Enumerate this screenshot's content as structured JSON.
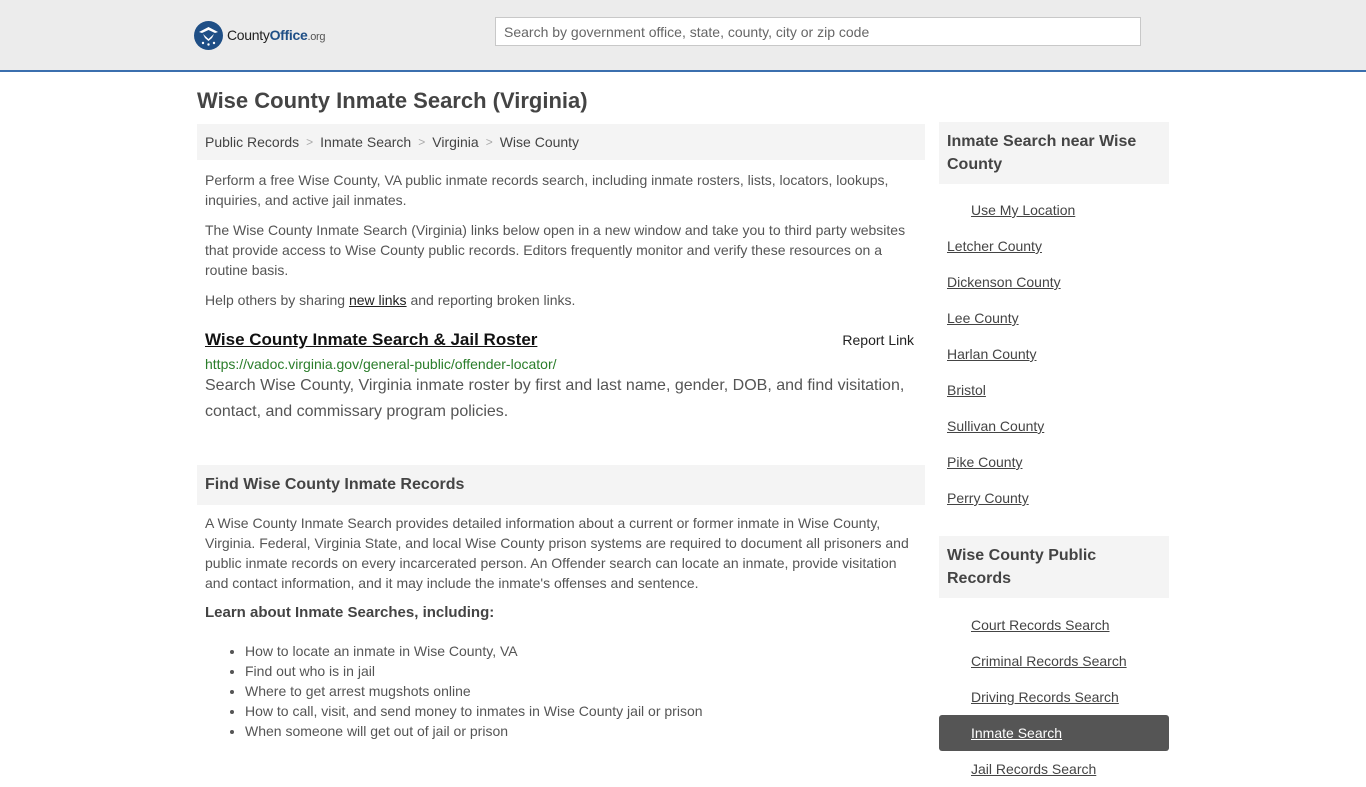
{
  "header": {
    "logo_name": "CountyOffice",
    "logo_county": "County",
    "logo_office": "Office",
    "logo_tld": ".org",
    "search_placeholder": "Search by government office, state, county, city or zip code"
  },
  "page_title": "Wise County Inmate Search (Virginia)",
  "breadcrumb": [
    "Public Records",
    "Inmate Search",
    "Virginia",
    "Wise County"
  ],
  "intro": {
    "p1": "Perform a free Wise County, VA public inmate records search, including inmate rosters, lists, locators, lookups, inquiries, and active jail inmates.",
    "p2": "The Wise County Inmate Search (Virginia) links below open in a new window and take you to third party websites that provide access to Wise County public records. Editors frequently monitor and verify these resources on a routine basis.",
    "p3_before": "Help others by sharing ",
    "p3_link": "new links",
    "p3_after": " and reporting broken links."
  },
  "result": {
    "title": "Wise County Inmate Search & Jail Roster",
    "report_label": "Report Link",
    "url": "https://vadoc.virginia.gov/general-public/offender-locator/",
    "description": "Search Wise County, Virginia inmate roster by first and last name, gender, DOB, and find visitation, contact, and commissary program policies."
  },
  "find_section": {
    "heading": "Find Wise County Inmate Records",
    "body": "A Wise County Inmate Search provides detailed information about a current or former inmate in Wise County, Virginia. Federal, Virginia State, and local Wise County prison systems are required to document all prisoners and public inmate records on every incarcerated person. An Offender search can locate an inmate, provide visitation and contact information, and it may include the inmate's offenses and sentence.",
    "learn_heading": "Learn about Inmate Searches, including:",
    "learn_items": [
      "How to locate an inmate in Wise County, VA",
      "Find out who is in jail",
      "Where to get arrest mugshots online",
      "How to call, visit, and send money to inmates in Wise County jail or prison",
      "When someone will get out of jail or prison"
    ]
  },
  "sidebar": {
    "nearby_heading": "Inmate Search near Wise County",
    "use_location": "Use My Location",
    "nearby": [
      "Letcher County",
      "Dickenson County",
      "Lee County",
      "Harlan County",
      "Bristol",
      "Sullivan County",
      "Pike County",
      "Perry County"
    ],
    "records_heading": "Wise County Public Records",
    "records": [
      "Court Records Search",
      "Criminal Records Search",
      "Driving Records Search",
      "Inmate Search",
      "Jail Records Search"
    ],
    "active_record": "Inmate Search"
  },
  "colors": {
    "accent": "#3b6fae",
    "logo": "#1f4f86",
    "url_green": "#2a7d2a",
    "active_bg": "#555555"
  }
}
